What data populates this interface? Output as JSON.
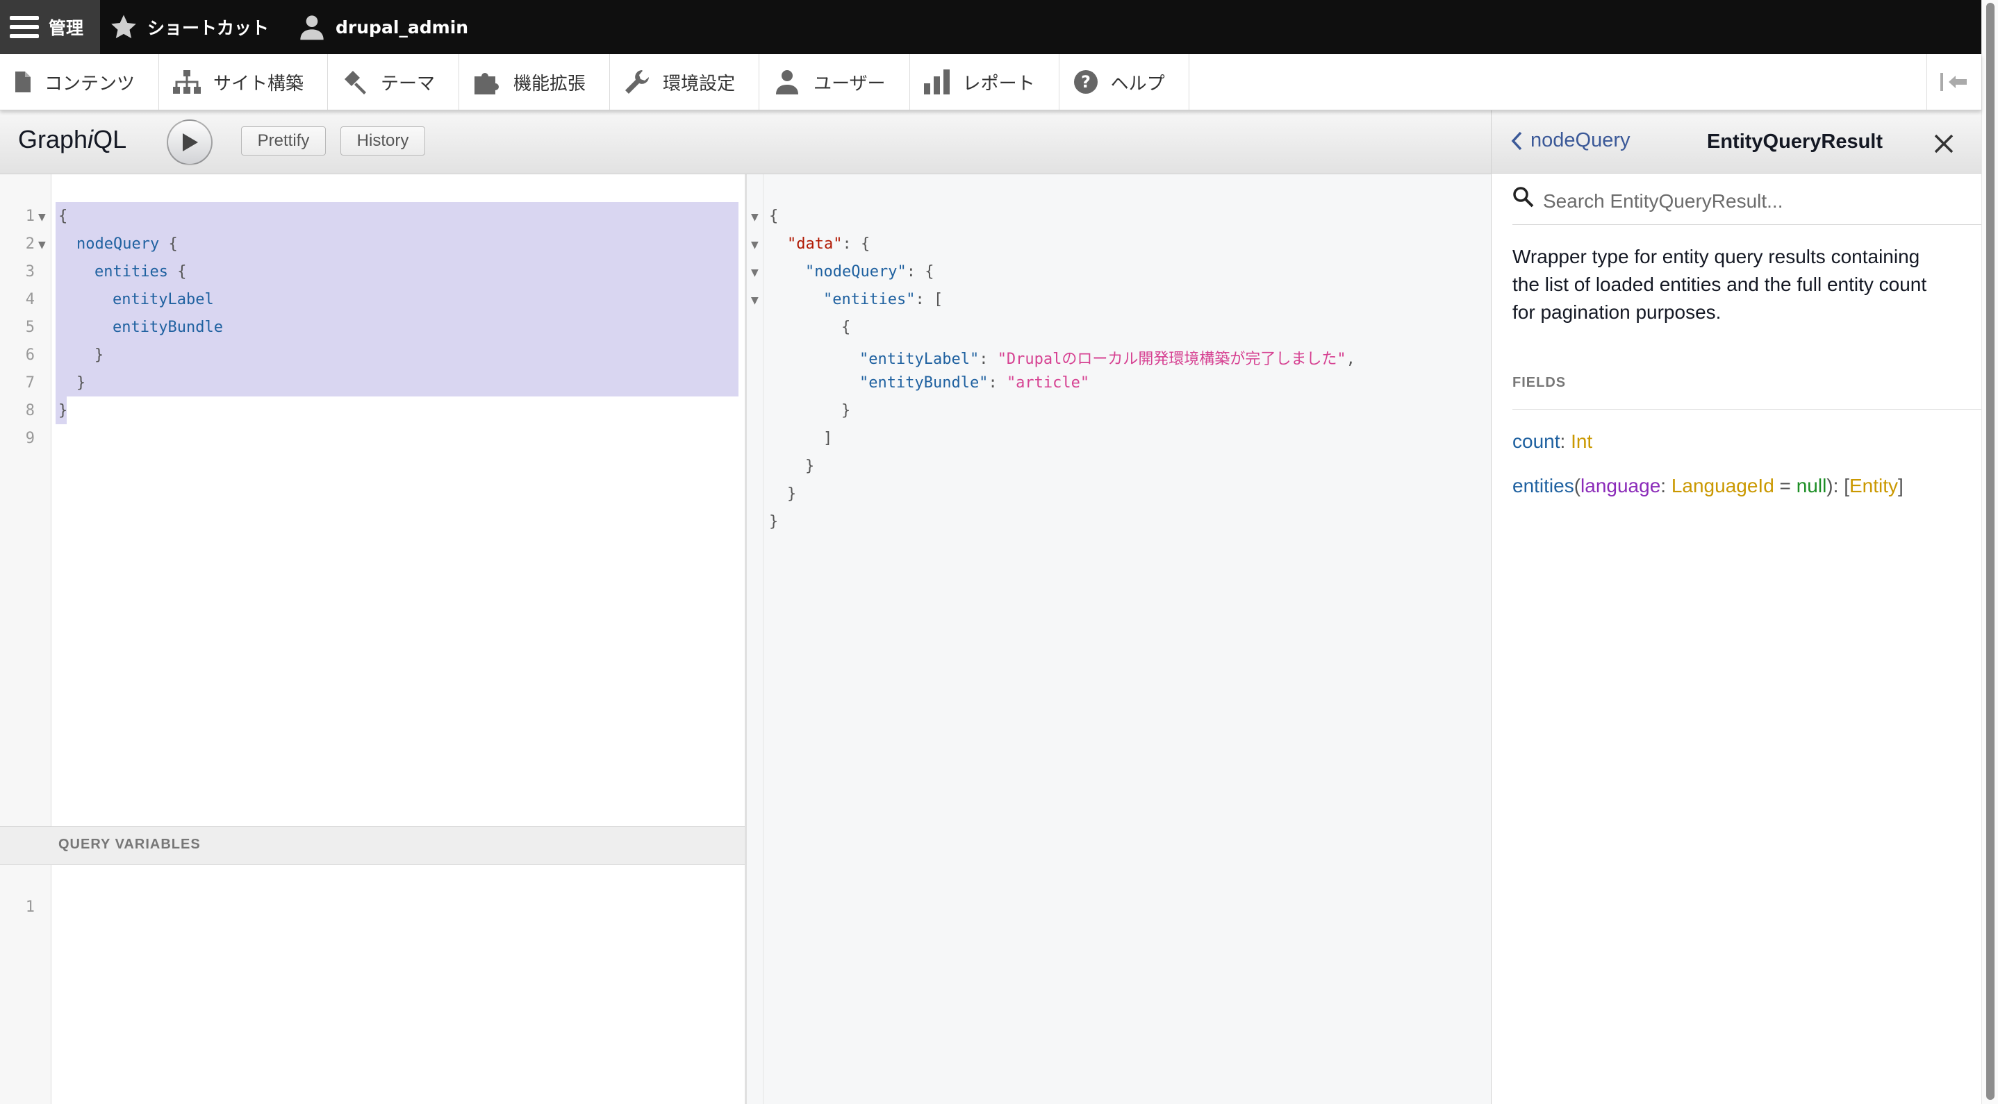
{
  "toolbar": {
    "manage_label": "管理",
    "shortcuts_label": "ショートカット",
    "user_label": "drupal_admin"
  },
  "tray": {
    "items": [
      {
        "label": "コンテンツ",
        "icon": "file-icon"
      },
      {
        "label": "サイト構築",
        "icon": "sitemap-icon"
      },
      {
        "label": "テーマ",
        "icon": "paint-icon"
      },
      {
        "label": "機能拡張",
        "icon": "puzzle-icon"
      },
      {
        "label": "環境設定",
        "icon": "wrench-icon"
      },
      {
        "label": "ユーザー",
        "icon": "people-icon"
      },
      {
        "label": "レポート",
        "icon": "bar-chart-icon"
      },
      {
        "label": "ヘルプ",
        "icon": "help-icon"
      }
    ]
  },
  "graphiql": {
    "title_prefix": "Graph",
    "title_italic": "i",
    "title_suffix": "QL",
    "prettify_label": "Prettify",
    "history_label": "History"
  },
  "query_editor": {
    "line_numbers": [
      "1",
      "2",
      "3",
      "4",
      "5",
      "6",
      "7",
      "8",
      "9"
    ],
    "lines": {
      "l1_brace": "{",
      "l2_field": "nodeQuery",
      "l2_brace": " {",
      "l3_field": "entities",
      "l3_brace": " {",
      "l4_field": "entityLabel",
      "l5_field": "entityBundle",
      "l6_brace": "}",
      "l7_brace": "}",
      "l8_brace": "}"
    }
  },
  "variables": {
    "title": "QUERY VARIABLES",
    "line_numbers": [
      "1"
    ]
  },
  "result": {
    "open_brace": "{",
    "data_key": "\"data\"",
    "node_query_key": "\"nodeQuery\"",
    "entities_key": "\"entities\"",
    "entity_label_key": "\"entityLabel\"",
    "entity_label_value": "\"Drupalのローカル開発環境構築が完了しました\"",
    "entity_bundle_key": "\"entityBundle\"",
    "entity_bundle_value": "\"article\"",
    "colon_brace": ": {",
    "colon_bracket": ": [",
    "inner_open": "{",
    "inner_close": "}",
    "bracket_close": "]",
    "brace_close": "}",
    "colon": ": ",
    "comma": ","
  },
  "docs": {
    "back_label": "nodeQuery",
    "title": "EntityQueryResult",
    "search_placeholder": "Search EntityQueryResult...",
    "description": "Wrapper type for entity query results containing the list of loaded entities and the full entity count for pagination purposes.",
    "fields_title": "FIELDS",
    "field_count_name": "count",
    "field_count_type": "Int",
    "field_entities_name": "entities",
    "field_entities_arg": "language",
    "field_entities_arg_type": "LanguageId",
    "field_entities_default": "null",
    "field_entities_type": "Entity",
    "sep_colon": ": ",
    "sep_open_paren": "(",
    "sep_close_paren": ")",
    "sep_equals": " = ",
    "sep_open_bracket": "[",
    "sep_close_bracket": "]"
  }
}
